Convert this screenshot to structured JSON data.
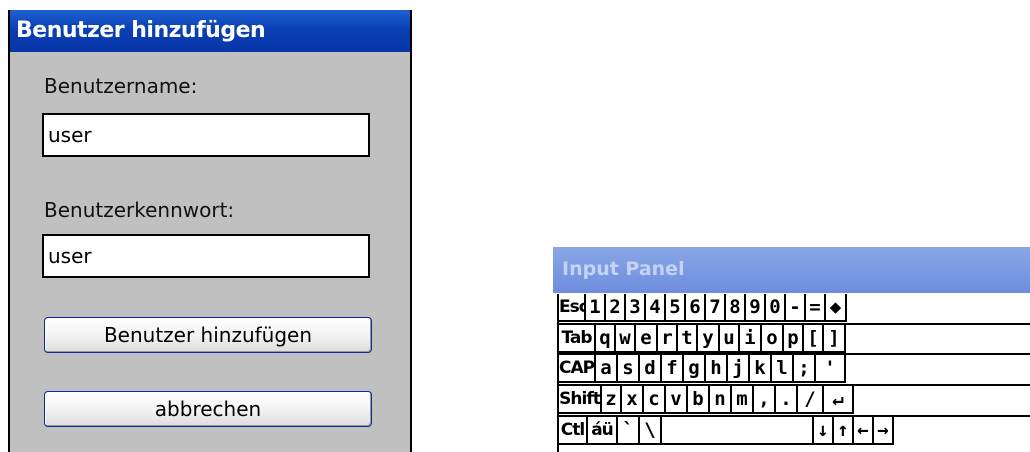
{
  "dialog": {
    "title": "Benutzer hinzufügen",
    "username_label": "Benutzername:",
    "username_value": "user",
    "password_label": "Benutzerkennwort:",
    "password_value": "user",
    "add_button": "Benutzer hinzufügen",
    "cancel_button": "abbrechen"
  },
  "input_panel": {
    "title": "Input Panel",
    "rows": [
      [
        "Esc",
        "1",
        "2",
        "3",
        "4",
        "5",
        "6",
        "7",
        "8",
        "9",
        "0",
        "-",
        "=",
        "◆"
      ],
      [
        "Tab",
        "q",
        "w",
        "e",
        "r",
        "t",
        "y",
        "u",
        "i",
        "o",
        "p",
        "[",
        "]"
      ],
      [
        "CAP",
        "a",
        "s",
        "d",
        "f",
        "g",
        "h",
        "j",
        "k",
        "l",
        ";",
        "'"
      ],
      [
        "Shift",
        "z",
        "x",
        "c",
        "v",
        "b",
        "n",
        "m",
        ",",
        ".",
        "/",
        "↵"
      ],
      [
        "Ctl",
        "áü",
        "`",
        "\\",
        "",
        "↓",
        "↑",
        "←",
        "→"
      ]
    ]
  }
}
